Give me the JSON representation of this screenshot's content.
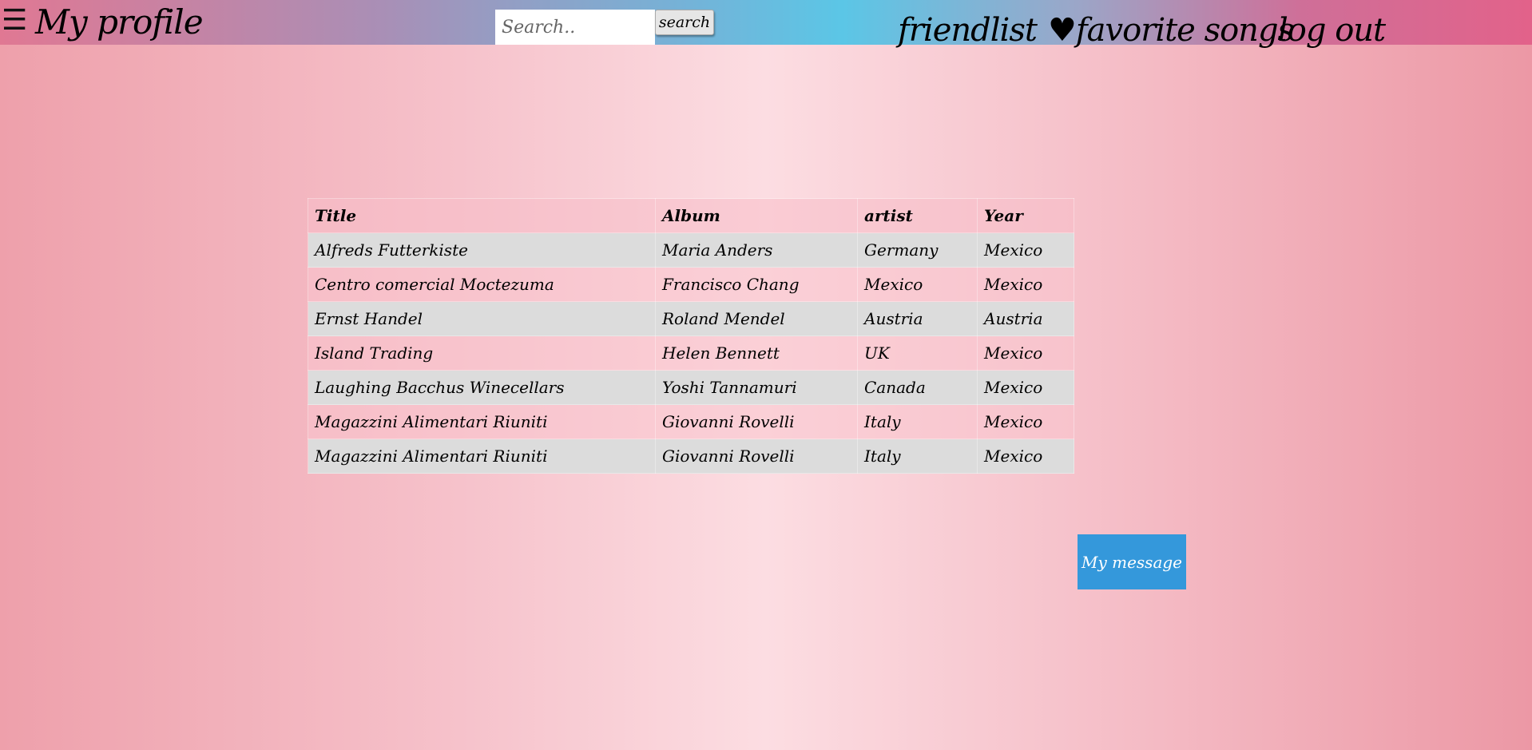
{
  "header": {
    "menu_glyph": "☰",
    "title": "My profile",
    "search": {
      "placeholder": "Search..",
      "value": "",
      "button_label": "search"
    },
    "nav": {
      "friendlist": "friendlist",
      "favorite_songs": "♥favorite songs",
      "log_out": "log out"
    },
    "colors": {
      "gradient_left": "#e07893",
      "gradient_center": "#5bc6e6",
      "gradient_right": "#e2628a"
    }
  },
  "table": {
    "columns": [
      "Title",
      "Album",
      "artist",
      "Year"
    ],
    "rows": [
      [
        "Alfreds Futterkiste",
        "Maria Anders",
        "Germany",
        "Mexico"
      ],
      [
        "Centro comercial Moctezuma",
        "Francisco Chang",
        "Mexico",
        "Mexico"
      ],
      [
        "Ernst Handel",
        "Roland Mendel",
        "Austria",
        "Austria"
      ],
      [
        "Island Trading",
        "Helen Bennett",
        "UK",
        "Mexico"
      ],
      [
        "Laughing Bacchus Winecellars",
        "Yoshi Tannamuri",
        "Canada",
        "Mexico"
      ],
      [
        "Magazzini Alimentari Riuniti",
        "Giovanni Rovelli",
        "Italy",
        "Mexico"
      ],
      [
        "Magazzini Alimentari Riuniti",
        "Giovanni Rovelli",
        "Italy",
        "Mexico"
      ]
    ]
  },
  "message_button": {
    "label": "My message",
    "color": "#3498db"
  },
  "page": {
    "background_edge": "#ec98a5",
    "background_center": "#fcdde2"
  }
}
